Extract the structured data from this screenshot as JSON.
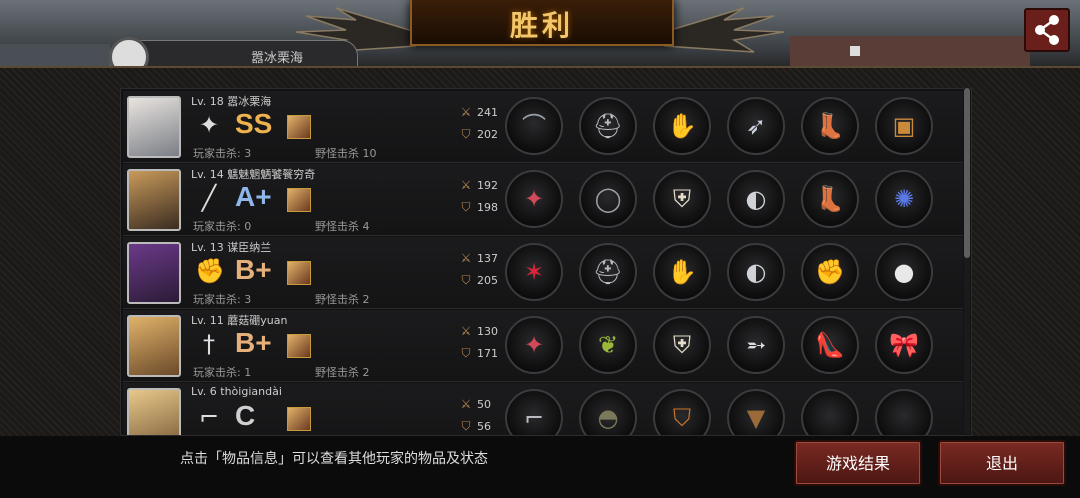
{
  "header": {
    "title": "胜利",
    "tab_text": "嚣冰栗海",
    "share_icon": "share-icon"
  },
  "players": [
    {
      "level_name": "Lv. 18  嚣冰栗海",
      "class_icon": "shuriken-icon",
      "grade": "SS",
      "player_kills": "玩家击杀: 3",
      "monster_kills": "野怪击杀 10",
      "attack": "241",
      "defense": "202",
      "items": [
        "boomerang-icon",
        "helmet-icon",
        "fire-glove-icon",
        "fish-blade-icon",
        "boots-icon",
        "treasure-chest-icon"
      ]
    },
    {
      "level_name": "Lv. 14  魑魅魍魉饕餮穷奇",
      "class_icon": "knife-icon",
      "grade": "A+",
      "player_kills": "玩家击杀: 0",
      "monster_kills": "野怪击杀 4",
      "attack": "192",
      "defense": "198",
      "items": [
        "spear-icon",
        "ring-icon",
        "armor-icon",
        "disc-icon",
        "boots-icon",
        "galaxy-icon"
      ]
    },
    {
      "level_name": "Lv. 13  谋臣纳兰",
      "class_icon": "fist-icon",
      "grade": "B+",
      "player_kills": "玩家击杀: 3",
      "monster_kills": "野怪击杀 2",
      "attack": "137",
      "defense": "205",
      "items": [
        "claw-icon",
        "helmet-icon",
        "fire-glove-icon",
        "disc-icon",
        "gauntlet-icon",
        "orb-icon"
      ]
    },
    {
      "level_name": "Lv. 11  蘑菇硼yuan",
      "class_icon": "rapier-icon",
      "grade": "B+",
      "player_kills": "玩家击杀: 1",
      "monster_kills": "野怪击杀 2",
      "attack": "130",
      "defense": "171",
      "items": [
        "spear-icon",
        "laurel-wreath-icon",
        "armor-icon",
        "blade-icon",
        "red-heels-icon",
        "ribbon-icon"
      ]
    },
    {
      "level_name": "Lv. 6  thòigiandài",
      "class_icon": "pistol-icon",
      "grade": "C",
      "player_kills": "",
      "monster_kills": "",
      "attack": "50",
      "defense": "56",
      "items": [
        "pistol-icon",
        "army-helmet-icon",
        "jacket-icon",
        "boot-icon",
        "empty-slot",
        "empty-slot"
      ]
    }
  ],
  "footer": {
    "hint": "点击「物品信息」可以查看其他玩家的物品及状态",
    "results_button": "游戏结果",
    "exit_button": "退出"
  },
  "colors": {
    "accent_gold": "#f3c66a",
    "button_red": "#6a1f1a"
  }
}
